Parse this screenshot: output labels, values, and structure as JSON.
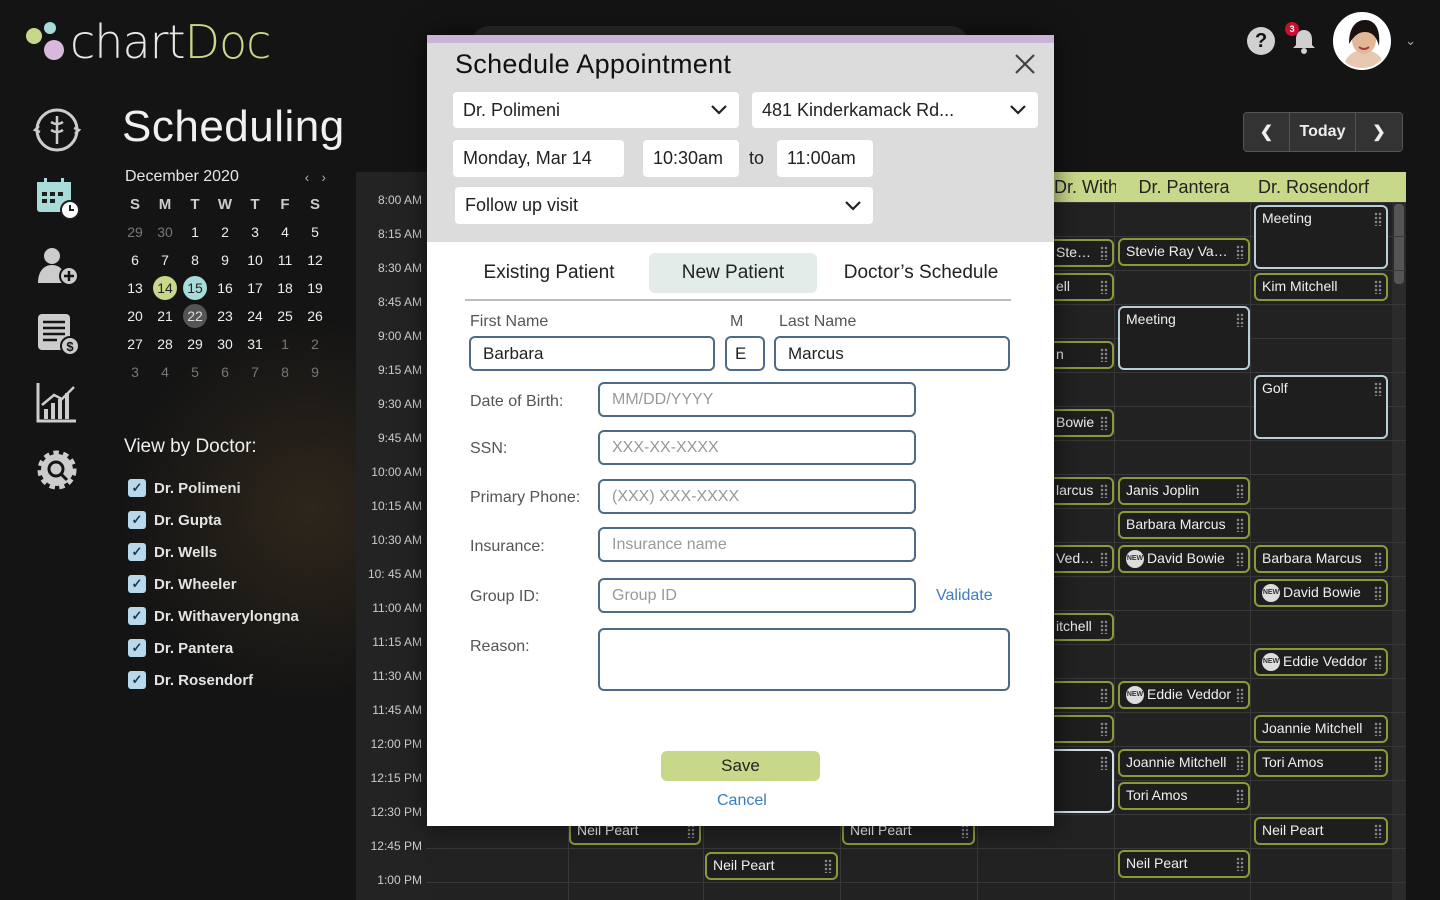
{
  "brand": {
    "name_part1": "chart",
    "name_part2": "Doc"
  },
  "header": {
    "notification_count": "3"
  },
  "page": {
    "title": "Scheduling"
  },
  "calendar": {
    "month": "December 2020",
    "dow": [
      "S",
      "M",
      "T",
      "W",
      "T",
      "F",
      "S"
    ],
    "weeks": [
      [
        "29",
        "30",
        "1",
        "2",
        "3",
        "4",
        "5"
      ],
      [
        "6",
        "7",
        "8",
        "9",
        "10",
        "11",
        "12"
      ],
      [
        "13",
        "14",
        "15",
        "16",
        "17",
        "18",
        "19"
      ],
      [
        "20",
        "21",
        "22",
        "23",
        "24",
        "25",
        "26"
      ],
      [
        "27",
        "28",
        "29",
        "30",
        "31",
        "1",
        "2"
      ],
      [
        "3",
        "4",
        "5",
        "6",
        "7",
        "8",
        "9"
      ]
    ]
  },
  "view_by_doctor": {
    "title": "View by Doctor:",
    "doctors": [
      "Dr. Polimeni",
      "Dr. Gupta",
      "Dr. Wells",
      "Dr. Wheeler",
      "Dr. Withaverylongna",
      "Dr. Pantera",
      "Dr. Rosendorf"
    ]
  },
  "date_nav": {
    "prev": "❮",
    "today": "Today",
    "next": "❯"
  },
  "schedule": {
    "times": [
      "8:00 AM",
      "8:15 AM",
      "8:30 AM",
      "8:45 AM",
      "9:00 AM",
      "9:15 AM",
      "9:30 AM",
      "9:45 AM",
      "10:00 AM",
      "10:15 AM",
      "10:30 AM",
      "10: 45 AM",
      "11:00 AM",
      "11:15 AM",
      "11:30 AM",
      "11:45 AM",
      "12:00 PM",
      "12:15 PM",
      "12:30 PM",
      "12:45 PM",
      "1:00 PM"
    ],
    "columns": [
      "Dr. Withaver...",
      "Dr. Pantera",
      "Dr. Rosendorf"
    ],
    "appointments": {
      "col5": [
        "Stevie Ray Vau...",
        "ell",
        "n",
        "Bowie",
        "larcus",
        "Veddor",
        "itchell",
        "",
        ""
      ],
      "col6": [
        "Stevie Ray Vau...",
        "Meeting",
        "Janis Joplin",
        "Barbara Marcus",
        "David Bowie",
        "Eddie Veddor",
        "Joannie Mitchell",
        "Tori Amos",
        "Neil Peart"
      ],
      "col7": [
        "Meeting",
        "Kim Mitchell",
        "Golf",
        "Barbara Marcus",
        "David Bowie",
        "Eddie Veddor",
        "Joannie Mitchell",
        "Tori Amos",
        "Neil Peart"
      ],
      "bottom": [
        "Neil Peart",
        "Neil Peart",
        "Neil Peart"
      ]
    },
    "new_badge": "NEW"
  },
  "modal": {
    "title": "Schedule Appointment",
    "doctor": "Dr. Polimeni",
    "location": "481 Kinderkamack Rd...",
    "date": "Monday, Mar 14",
    "start_time": "10:30am",
    "to": "to",
    "end_time": "11:00am",
    "visit_type": "Follow up visit",
    "tabs": [
      "Existing Patient",
      "New Patient",
      "Doctor’s Schedule"
    ],
    "labels": {
      "first_name": "First Name",
      "middle": "M",
      "last_name": "Last Name",
      "dob": "Date of Birth:",
      "ssn": "SSN:",
      "phone": "Primary Phone:",
      "insurance": "Insurance:",
      "group_id": "Group ID:",
      "reason": "Reason:"
    },
    "values": {
      "first_name": "Barbara",
      "middle": "E",
      "last_name": "Marcus"
    },
    "placeholders": {
      "dob": "MM/DD/YYYY",
      "ssn": "XXX-XX-XXXX",
      "phone": "(XXX) XXX-XXXX",
      "insurance": "Insurance name",
      "group_id": "Group ID"
    },
    "validate": "Validate",
    "save": "Save",
    "cancel": "Cancel"
  },
  "colors": {
    "accent": "#c8d88a",
    "teal": "#a8dcd8",
    "link": "#3b7dc0",
    "modal_top": "#dcdcdc"
  }
}
